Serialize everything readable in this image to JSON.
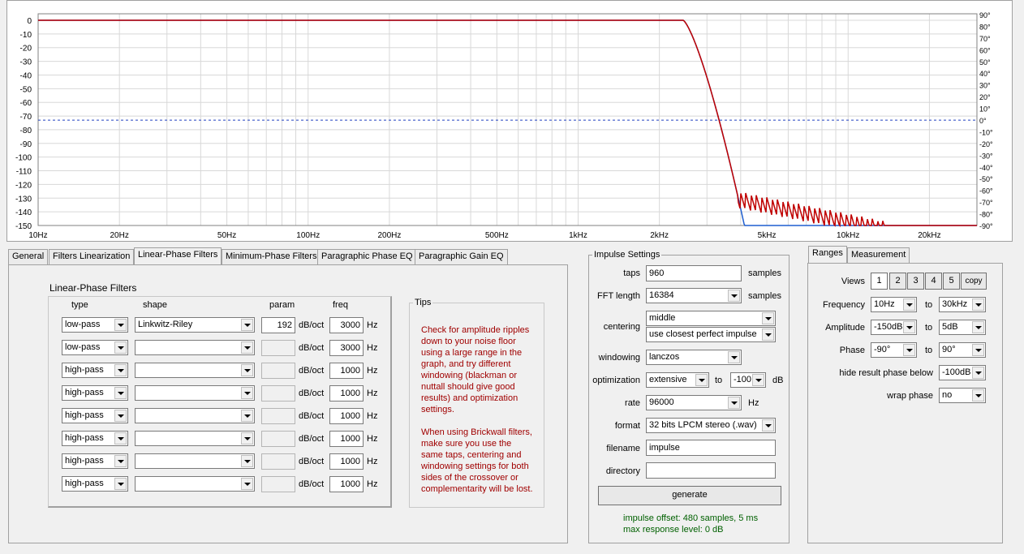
{
  "graph": {
    "y_ticks": [
      "0",
      "-10",
      "-20",
      "-30",
      "-40",
      "-50",
      "-60",
      "-70",
      "-80",
      "-90",
      "-100",
      "-110",
      "-120",
      "-130",
      "-140",
      "-150"
    ],
    "phase_ticks": [
      "90°",
      "80°",
      "70°",
      "60°",
      "50°",
      "40°",
      "30°",
      "20°",
      "10°",
      "0°",
      "-10°",
      "-20°",
      "-30°",
      "-40°",
      "-50°",
      "-60°",
      "-70°",
      "-80°",
      "-90°"
    ],
    "x_ticks": [
      {
        "f": 10,
        "label": "10Hz"
      },
      {
        "f": 20,
        "label": "20Hz"
      },
      {
        "f": 50,
        "label": "50Hz"
      },
      {
        "f": 100,
        "label": "100Hz"
      },
      {
        "f": 200,
        "label": "200Hz"
      },
      {
        "f": 500,
        "label": "500Hz"
      },
      {
        "f": 1000,
        "label": "1kHz"
      },
      {
        "f": 2000,
        "label": "2kHz"
      },
      {
        "f": 5000,
        "label": "5kHz"
      },
      {
        "f": 10000,
        "label": "10kHz"
      },
      {
        "f": 20000,
        "label": "20kHz"
      }
    ],
    "freq_range": [
      10,
      30000
    ],
    "db_range": [
      -150,
      5
    ],
    "floor_line_db": -73,
    "colors": {
      "target": "#1f5fd0",
      "result": "#c00000",
      "floor": "#2040c0",
      "grid": "#d8d8d8"
    }
  },
  "tabs": [
    "General",
    "Filters Linearization",
    "Linear-Phase Filters",
    "Minimum-Phase Filters",
    "Paragraphic Phase EQ",
    "Paragraphic Gain EQ"
  ],
  "lp": {
    "title": "Linear-Phase Filters",
    "headers": {
      "type": "type",
      "shape": "shape",
      "param": "param",
      "freq": "freq"
    },
    "unit_slope": "dB/oct",
    "unit_hz": "Hz",
    "rows": [
      {
        "type": "low-pass",
        "shape": "Linkwitz-Riley",
        "param": "192",
        "freq": "3000"
      },
      {
        "type": "low-pass",
        "shape": "",
        "param": "",
        "freq": "3000"
      },
      {
        "type": "high-pass",
        "shape": "",
        "param": "",
        "freq": "1000"
      },
      {
        "type": "high-pass",
        "shape": "",
        "param": "",
        "freq": "1000"
      },
      {
        "type": "high-pass",
        "shape": "",
        "param": "",
        "freq": "1000"
      },
      {
        "type": "high-pass",
        "shape": "",
        "param": "",
        "freq": "1000"
      },
      {
        "type": "high-pass",
        "shape": "",
        "param": "",
        "freq": "1000"
      },
      {
        "type": "high-pass",
        "shape": "",
        "param": "",
        "freq": "1000"
      }
    ]
  },
  "tips": {
    "title": "Tips",
    "p1": [
      "Check for amplitude ripples",
      "down to your noise floor",
      "using a large range in the",
      "graph, and try different",
      "windowing (blackman or",
      "nuttall should give good",
      "results) and optimization",
      "settings."
    ],
    "p2": [
      "When using Brickwall filters,",
      "make sure you use the",
      "same taps, centering and",
      "windowing settings for both",
      "sides of the crossover or",
      "complementarity will be lost."
    ]
  },
  "impulse": {
    "title": "Impulse Settings",
    "taps_label": "taps",
    "taps": "960",
    "samples": "samples",
    "fft_label": "FFT length",
    "fft": "16384",
    "centering_label": "centering",
    "centering1": "middle",
    "centering2": "use closest perfect impulse",
    "windowing_label": "windowing",
    "windowing": "lanczos",
    "opt_label": "optimization",
    "opt": "extensive",
    "to": "to",
    "opt_db": "-100",
    "db": "dB",
    "rate_label": "rate",
    "rate": "96000",
    "hz": "Hz",
    "format_label": "format",
    "format": "32 bits LPCM stereo (.wav)",
    "filename_label": "filename",
    "filename": "impulse",
    "directory_label": "directory",
    "directory": "",
    "generate": "generate",
    "status1": "impulse offset: 480 samples, 5 ms",
    "status2": "max response level: 0 dB"
  },
  "ranges": {
    "tabs": [
      "Ranges",
      "Measurement"
    ],
    "views_label": "Views",
    "views": [
      "1",
      "2",
      "3",
      "4",
      "5"
    ],
    "copy": "copy",
    "to": "to",
    "freq_label": "Frequency",
    "freq_from": "10Hz",
    "freq_to": "30kHz",
    "amp_label": "Amplitude",
    "amp_from": "-150dB",
    "amp_to": "5dB",
    "phase_label": "Phase",
    "phase_from": "-90°",
    "phase_to": "90°",
    "hide_label": "hide result phase below",
    "hide": "-100dB",
    "wrap_label": "wrap phase",
    "wrap": "no"
  }
}
